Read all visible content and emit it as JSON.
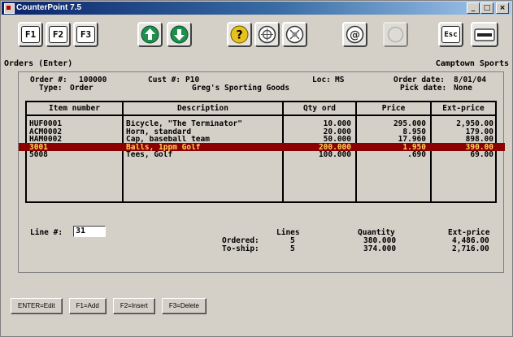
{
  "window": {
    "title": "CounterPoint 7.5",
    "buttons": {
      "minimize": "_",
      "maximize": "□",
      "close": "×"
    }
  },
  "toolbar": {
    "f1": "F1",
    "f2": "F2",
    "f3": "F3",
    "esc": "Esc",
    "icons": [
      "arrow-up-icon",
      "arrow-down-icon",
      "help-icon",
      "lookup-icon",
      "filter-icon",
      "email-icon",
      "blank-icon",
      "keyboard-icon"
    ]
  },
  "status": {
    "left": "Orders (Enter)",
    "right": "Camptown Sports"
  },
  "header": {
    "order_label": "Order #:",
    "order_value": "100000",
    "type_label": "Type:",
    "type_value": "Order",
    "cust_label": "Cust #:",
    "cust_value": "P10",
    "cust_name": "Greg's Sporting Goods",
    "loc_label": "Loc:",
    "loc_value": "MS",
    "order_date_label": "Order date:",
    "order_date_value": "8/01/04",
    "pick_date_label": "Pick date:",
    "pick_date_value": "None"
  },
  "table": {
    "columns": [
      "Item number",
      "Description",
      "Qty ord",
      "Price",
      "Ext-price"
    ],
    "rows": [
      {
        "item": "HUF0001",
        "desc": "Bicycle, \"The Terminator\"",
        "qty": "10.000",
        "price": "295.000",
        "ext": "2,950.00"
      },
      {
        "item": "ACM0002",
        "desc": "Horn, standard",
        "qty": "20.000",
        "price": "8.950",
        "ext": "179.00"
      },
      {
        "item": "HAM0002",
        "desc": "Cap, baseball team",
        "qty": "50.000",
        "price": "17.960",
        "ext": "898.00"
      },
      {
        "item": "3001",
        "desc": "Balls, 1ppm Golf",
        "qty": "200.000",
        "price": "1.950",
        "ext": "390.00"
      },
      {
        "item": "5008",
        "desc": "Tees, Golf",
        "qty": "100.000",
        "price": ".690",
        "ext": "69.00"
      }
    ],
    "selected_index": 3
  },
  "line": {
    "label": "Line #:",
    "value": "31"
  },
  "totals": {
    "headers": {
      "lines": "Lines",
      "quantity": "Quantity",
      "ext_price": "Ext-price"
    },
    "ordered": {
      "label": "Ordered:",
      "lines": "5",
      "quantity": "380.000",
      "ext_price": "4,486.00"
    },
    "to_ship": {
      "label": "To-ship:",
      "lines": "5",
      "quantity": "374.000",
      "ext_price": "2,716.00"
    }
  },
  "function_buttons": [
    "ENTER=Edit",
    "F1=Add",
    "F2=Insert",
    "F3=Delete"
  ]
}
